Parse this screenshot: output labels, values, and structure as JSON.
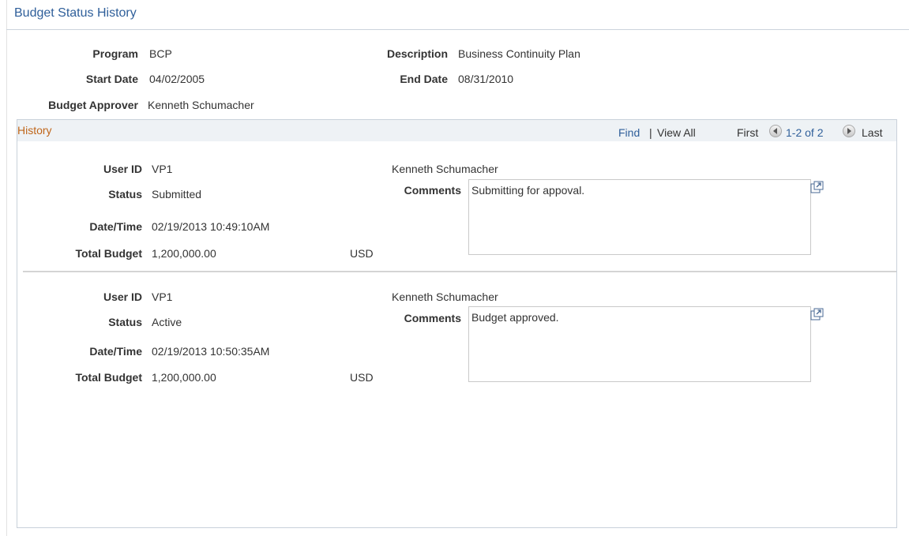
{
  "page": {
    "title": "Budget Status History"
  },
  "header_fields": {
    "program_label": "Program",
    "program_value": "BCP",
    "description_label": "Description",
    "description_value": "Business Continuity Plan",
    "start_date_label": "Start Date",
    "start_date_value": "04/02/2005",
    "end_date_label": "End Date",
    "end_date_value": "08/31/2010",
    "approver_label": "Budget Approver",
    "approver_value": "Kenneth Schumacher"
  },
  "history": {
    "title": "History",
    "find": "Find",
    "separator": "|",
    "view_all": "View All",
    "first": "First",
    "range": "1-2 of 2",
    "last": "Last",
    "labels": {
      "user_id": "User ID",
      "status": "Status",
      "comments": "Comments",
      "date_time": "Date/Time",
      "total_budget": "Total Budget"
    },
    "rows": [
      {
        "user_id": "VP1",
        "user_name": "Kenneth Schumacher",
        "status": "Submitted",
        "comments": "Submitting for appoval.",
        "date_time": "02/19/2013 10:49:10AM",
        "total_budget": "1,200,000.00",
        "currency": "USD"
      },
      {
        "user_id": "VP1",
        "user_name": "Kenneth Schumacher",
        "status": "Active",
        "comments": "Budget approved.",
        "date_time": "02/19/2013 10:50:35AM",
        "total_budget": "1,200,000.00",
        "currency": "USD"
      }
    ]
  },
  "icons": {
    "first_arrow": "arrow-left-circle-icon",
    "last_arrow": "arrow-right-circle-icon",
    "expand": "expand-window-icon"
  }
}
